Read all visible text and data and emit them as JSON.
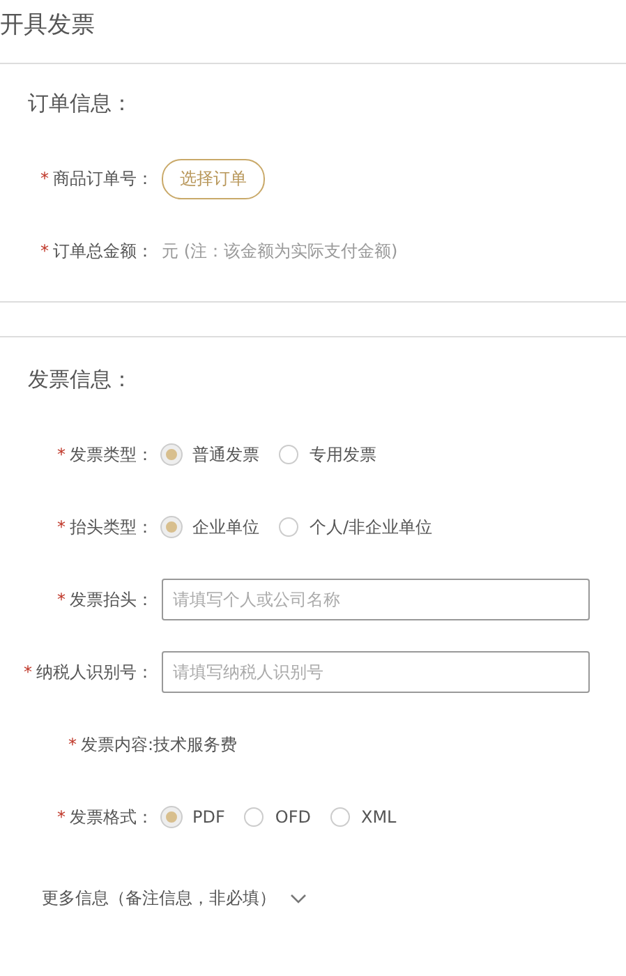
{
  "page_title": "开具发票",
  "sections": [
    {
      "title": "订单信息：",
      "fields": [
        {
          "kind": "button",
          "required_mark": "*",
          "label": "商品订单号：",
          "button": "选择订单"
        },
        {
          "kind": "text",
          "required_mark": "*",
          "label": "订单总金额：",
          "value": "元 (注：该金额为实际支付金额)"
        }
      ]
    },
    {
      "title": "发票信息：",
      "fields": [
        {
          "kind": "radio",
          "required_mark": "*",
          "label": "发票类型：",
          "options": [
            {
              "label": "普通发票",
              "selected": true
            },
            {
              "label": "专用发票",
              "selected": false
            }
          ]
        },
        {
          "kind": "radio",
          "required_mark": "*",
          "label": "抬头类型：",
          "options": [
            {
              "label": "企业单位",
              "selected": true
            },
            {
              "label": "个人/非企业单位",
              "selected": false
            }
          ]
        },
        {
          "kind": "input",
          "required_mark": "*",
          "label": "发票抬头：",
          "placeholder": "请填写个人或公司名称"
        },
        {
          "kind": "input",
          "required_mark": "*",
          "label": "纳税人识别号：",
          "placeholder": "请填写纳税人识别号"
        },
        {
          "kind": "content",
          "required_mark": "*",
          "label": "发票内容:",
          "value": "技术服务费"
        },
        {
          "kind": "radio",
          "required_mark": "*",
          "label": "发票格式：",
          "options": [
            {
              "label": "PDF",
              "selected": true
            },
            {
              "label": "OFD",
              "selected": false
            },
            {
              "label": "XML",
              "selected": false
            }
          ]
        }
      ]
    }
  ],
  "more_info": {
    "label": "更多信息（备注信息，非必填）",
    "expanded": false
  }
}
